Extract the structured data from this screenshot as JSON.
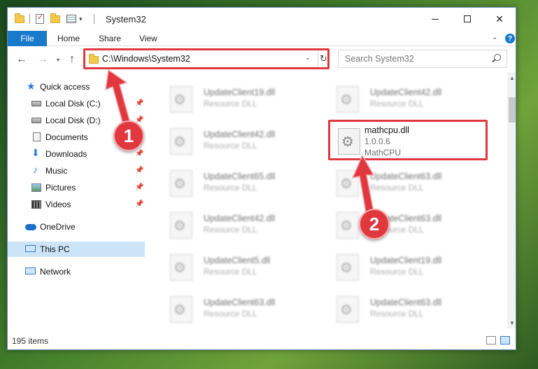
{
  "window": {
    "title": "System32",
    "controls": {
      "minimize": "",
      "maximize": "",
      "close": "✕"
    }
  },
  "ribbon": {
    "tabs": [
      "File",
      "Home",
      "Share",
      "View"
    ],
    "help": "?"
  },
  "nav": {
    "back": "←",
    "forward": "→",
    "recent": "▾",
    "up": "↑",
    "address": "C:\\Windows\\System32",
    "refresh": "↻",
    "search_placeholder": "Search System32"
  },
  "sidebar": {
    "quick_access": "Quick access",
    "items": [
      {
        "label": "Local Disk (C:)",
        "icon": "disk-icon",
        "pinned": true
      },
      {
        "label": "Local Disk (D:)",
        "icon": "disk-icon",
        "pinned": true
      },
      {
        "label": "Documents",
        "icon": "documents-icon",
        "pinned": true
      },
      {
        "label": "Downloads",
        "icon": "downloads-icon",
        "pinned": true
      },
      {
        "label": "Music",
        "icon": "music-icon",
        "pinned": true
      },
      {
        "label": "Pictures",
        "icon": "pictures-icon",
        "pinned": true
      },
      {
        "label": "Videos",
        "icon": "videos-icon",
        "pinned": true
      }
    ],
    "onedrive": "OneDrive",
    "this_pc": "This PC",
    "network": "Network"
  },
  "files": [
    {
      "name": "UpdateClient19.dll",
      "desc": "Resource DLL"
    },
    {
      "name": "UpdateClient42.dll",
      "desc": "Resource DLL"
    },
    {
      "name": "UpdateClient42.dll",
      "desc": "Resource DLL"
    },
    {
      "name": "mathcpu.dll",
      "version": "1.0.0.6",
      "desc": "MathCPU",
      "highlighted": true
    },
    {
      "name": "UpdateClient65.dll",
      "desc": "Resource DLL"
    },
    {
      "name": "UpdateClient63.dll",
      "desc": "Resource DLL"
    },
    {
      "name": "UpdateClient42.dll",
      "desc": "Resource DLL"
    },
    {
      "name": "UpdateClient63.dll",
      "desc": "Resource DLL"
    },
    {
      "name": "UpdateClient5.dll",
      "desc": "Resource DLL"
    },
    {
      "name": "UpdateClient19.dll",
      "desc": "Resource DLL"
    },
    {
      "name": "UpdateClient63.dll",
      "desc": "Resource DLL"
    },
    {
      "name": "UpdateClient63.dll",
      "desc": "Resource DLL"
    }
  ],
  "status": {
    "item_count": "195 items"
  },
  "callouts": {
    "step1": "1",
    "step2": "2"
  },
  "colors": {
    "accent": "#1979ca",
    "highlight": "#e0383e",
    "selected": "#cce4f7"
  }
}
